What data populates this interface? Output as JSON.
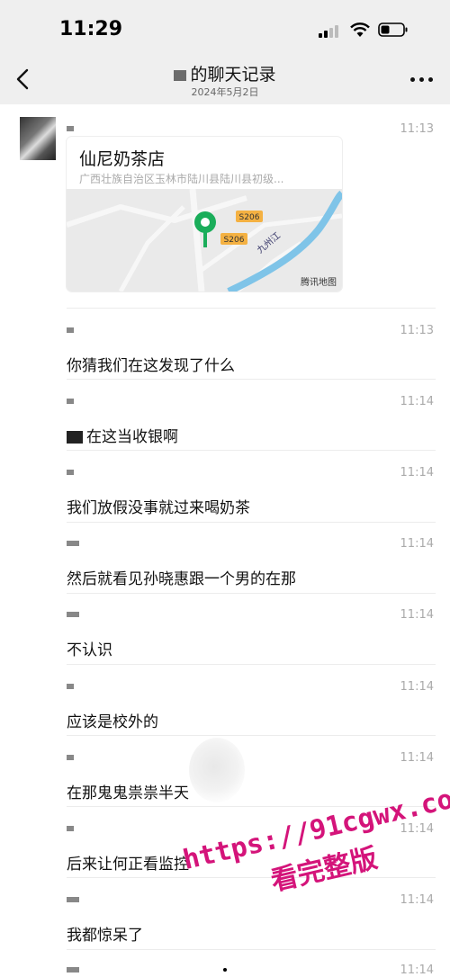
{
  "status_bar": {
    "time": "11:29"
  },
  "nav": {
    "title": "的聊天记录",
    "date": "2024年5月2日"
  },
  "location_message": {
    "time": "11:13",
    "place_name": "仙尼奶茶店",
    "address": "广西壮族自治区玉林市陆川县陆川县初级...",
    "map_labels": {
      "road1": "S206",
      "road2": "S206",
      "river": "九州江",
      "brand": "腾讯地图"
    }
  },
  "messages": [
    {
      "time": "11:13",
      "text": "你猜我们在这发现了什么"
    },
    {
      "time": "11:14",
      "text": "在这当收银啊"
    },
    {
      "time": "11:14",
      "text": "我们放假没事就过来喝奶茶"
    },
    {
      "time": "11:14",
      "text": "然后就看见孙晓惠跟一个男的在那"
    },
    {
      "time": "11:14",
      "text": "不认识"
    },
    {
      "time": "11:14",
      "text": "应该是校外的"
    },
    {
      "time": "11:14",
      "text": "在那鬼鬼祟祟半天"
    },
    {
      "time": "11:14",
      "text": "后来让何正看监控"
    },
    {
      "time": "11:14",
      "text": "我都惊呆了"
    },
    {
      "time": "11:14",
      "text": ""
    }
  ],
  "watermark": {
    "line1": "https://91cgwx.com",
    "line2": "看完整版"
  },
  "colors": {
    "watermark": "#d4147a",
    "map_pin": "#1aad5a",
    "river": "#7fc4e8"
  }
}
